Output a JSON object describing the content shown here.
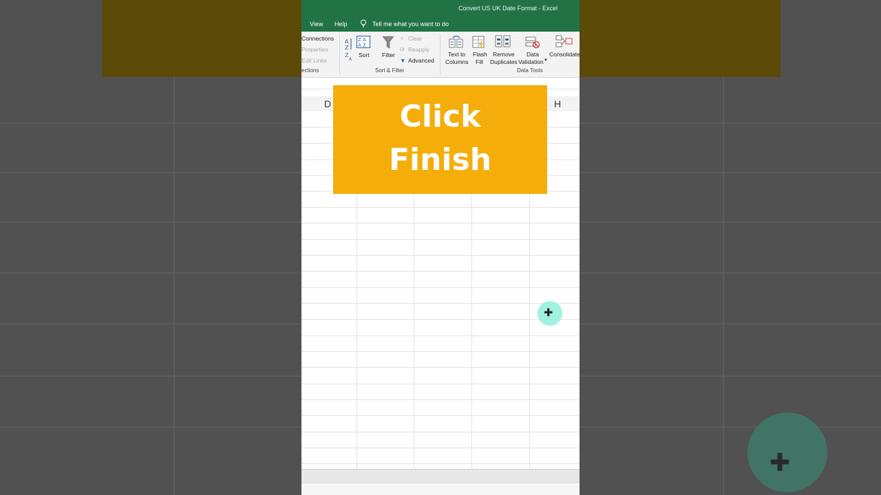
{
  "window": {
    "title": "Convert US UK Date Format  -  Excel"
  },
  "menu": {
    "items": [
      "View",
      "Help"
    ],
    "tell_me": "Tell me what you want to do"
  },
  "ribbon": {
    "connections": {
      "items": [
        "Connections",
        "Properties",
        "Edit Links"
      ],
      "group_label": "ections"
    },
    "sort_filter": {
      "sort_label": "Sort",
      "filter_label": "Filter",
      "clear_label": "Clear",
      "reapply_label": "Reapply",
      "advanced_label": "Advanced",
      "group_label": "Sort & Filter"
    },
    "data_tools": {
      "text_to_columns": [
        "Text to",
        "Columns"
      ],
      "flash_fill": [
        "Flash",
        "Fill"
      ],
      "remove_duplicates": [
        "Remove",
        "Duplicates"
      ],
      "data_validation": [
        "Data",
        "Validation"
      ],
      "consolidate": "Consolidate",
      "group_label": "Data Tools"
    }
  },
  "columns": {
    "left": "D",
    "right": "H"
  },
  "callout": {
    "lines": [
      "Click",
      "Finish"
    ]
  },
  "colors": {
    "excel_green": "#217346",
    "callout": "#f5ad0a",
    "cursor": "#8ff0dc"
  },
  "icons": {
    "tell_me": "lightbulb-icon",
    "sort": "sort-az-icon",
    "filter": "funnel-icon",
    "text_to_columns": "text-to-columns-icon",
    "flash_fill": "flash-fill-icon",
    "remove_duplicates": "remove-duplicates-icon",
    "data_validation": "data-validation-icon",
    "consolidate": "consolidate-icon",
    "cursor": "cursor-crosshair-icon"
  }
}
